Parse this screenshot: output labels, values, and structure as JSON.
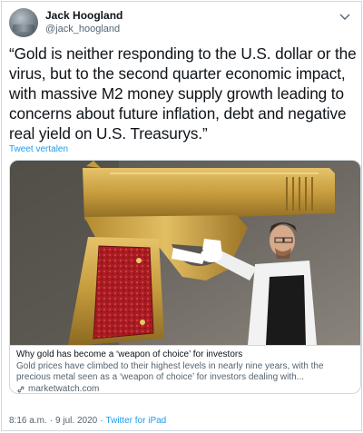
{
  "user": {
    "display_name": "Jack Hoogland",
    "handle": "@jack_hoogland"
  },
  "tweet": {
    "text": "“Gold is neither responding to the U.S. dollar or the virus, but to the second quarter economic impact, with massive M2 money supply growth leading to concerns about future inflation, debt and negative real yield on U.S. Treasurys.”",
    "translate_label": "Tweet vertalen"
  },
  "card": {
    "title": "Why gold has become a ‘weapon of choice’ for investors",
    "description": "Gold prices have climbed to their highest levels in nearly nine years, with the precious metal seen as a ‘weapon of choice’ for investors dealing with...",
    "source": "marketwatch.com",
    "icons": {
      "link": "link-icon"
    }
  },
  "meta": {
    "time": "8:16 a.m.",
    "date": "9 jul. 2020",
    "separator": "·",
    "client": "Twitter for iPad"
  },
  "colors": {
    "accent": "#1d9bf0",
    "text": "#0f1419",
    "secondary": "#536471",
    "border": "#cfd9de"
  },
  "icons": {
    "more": "more-icon"
  }
}
